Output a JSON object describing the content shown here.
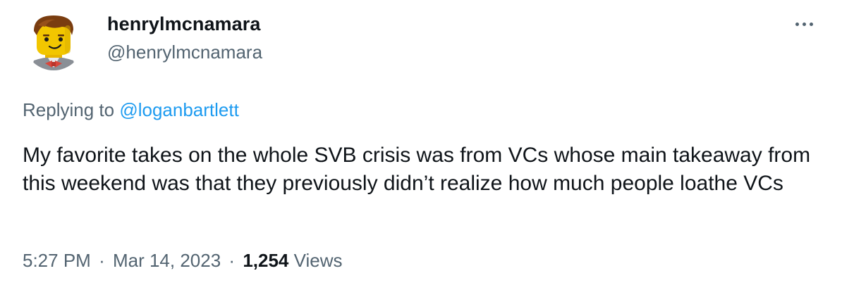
{
  "tweet": {
    "author": {
      "display_name": "henrylmcnamara",
      "handle": "@henrylmcnamara",
      "avatar_icon": "lego-minifigure-avatar"
    },
    "more_icon": "more-options-icon",
    "reply": {
      "prefix": "Replying to",
      "mention": "@loganbartlett"
    },
    "text": "My favorite takes on the whole SVB crisis was from VCs whose main takeaway from this weekend was that they previously didn’t realize how much people loathe VCs",
    "meta": {
      "time": "5:27 PM",
      "separator": "·",
      "date": "Mar 14, 2023",
      "views_count": "1,254",
      "views_label": "Views"
    }
  },
  "colors": {
    "primary_text": "#0f1419",
    "secondary_text": "#536471",
    "link": "#1d9bf0",
    "background": "#ffffff"
  }
}
